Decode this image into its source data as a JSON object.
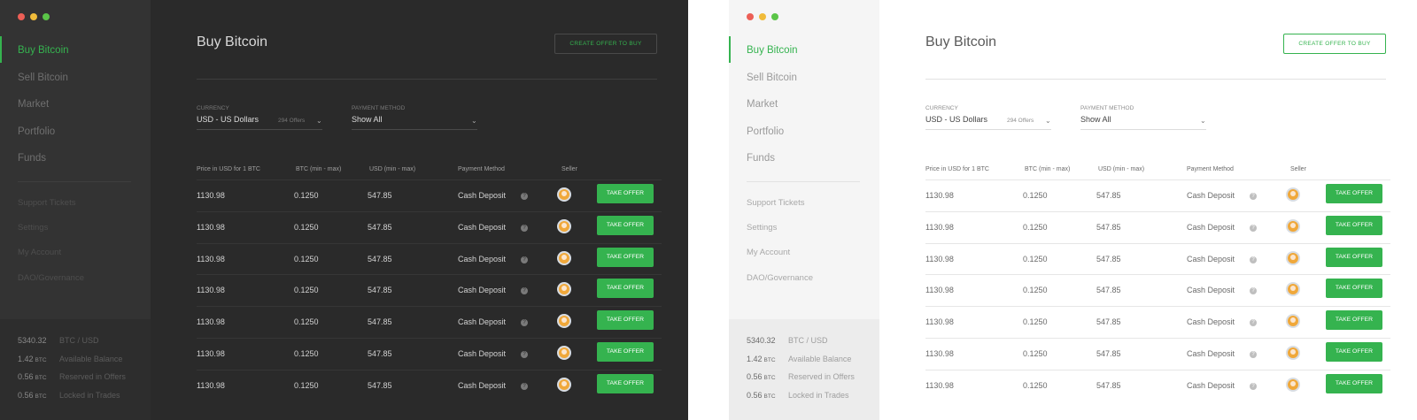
{
  "themes": [
    "dark",
    "light"
  ],
  "colors": {
    "accent": "#35b34f",
    "dark_bg": "#2a2a2a",
    "light_bg": "#ffffff"
  },
  "sidebar": {
    "primary_items": [
      "Buy Bitcoin",
      "Sell Bitcoin",
      "Market",
      "Portfolio",
      "Funds"
    ],
    "active_item": "Buy Bitcoin",
    "secondary_items": [
      "Support Tickets",
      "Settings",
      "My Account",
      "DAO/Governance"
    ],
    "balances": [
      {
        "value": "5340.32",
        "unit": "",
        "label": "BTC / USD"
      },
      {
        "value": "1.42",
        "unit": "BTC",
        "label": "Available Balance"
      },
      {
        "value": "0.56",
        "unit": "BTC",
        "label": "Reserved in Offers"
      },
      {
        "value": "0.56",
        "unit": "BTC",
        "label": "Locked in Trades"
      }
    ]
  },
  "main": {
    "title": "Buy Bitcoin",
    "create_button": "CREATE OFFER TO BUY",
    "currency": {
      "label": "CURRENCY",
      "value": "USD - US Dollars",
      "offers": "294 Offers"
    },
    "payment": {
      "label": "PAYMENT METHOD",
      "value": "Show All"
    },
    "columns": [
      "Price in USD for 1 BTC",
      "BTC (min - max)",
      "USD (min - max)",
      "Payment Method",
      "Seller"
    ],
    "take_label": "TAKE OFFER",
    "rows": [
      {
        "price": "1130.98",
        "btc": "0.1250",
        "usd": "547.85",
        "method": "Cash Deposit"
      },
      {
        "price": "1130.98",
        "btc": "0.1250",
        "usd": "547.85",
        "method": "Cash Deposit"
      },
      {
        "price": "1130.98",
        "btc": "0.1250",
        "usd": "547.85",
        "method": "Cash Deposit"
      },
      {
        "price": "1130.98",
        "btc": "0.1250",
        "usd": "547.85",
        "method": "Cash Deposit"
      },
      {
        "price": "1130.98",
        "btc": "0.1250",
        "usd": "547.85",
        "method": "Cash Deposit"
      },
      {
        "price": "1130.98",
        "btc": "0.1250",
        "usd": "547.85",
        "method": "Cash Deposit"
      },
      {
        "price": "1130.98",
        "btc": "0.1250",
        "usd": "547.85",
        "method": "Cash Deposit"
      }
    ]
  }
}
